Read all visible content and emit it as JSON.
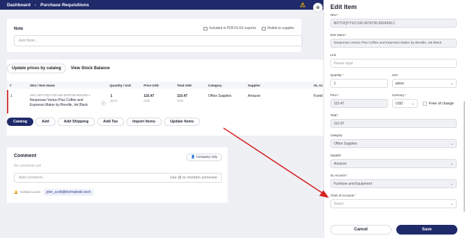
{
  "breadcrumb": {
    "home": "Dashboard",
    "sep": "›",
    "current": "Purchase Requisitions"
  },
  "note": {
    "title": "Note",
    "flag_pdf": "Included in PDF/XLSX exports",
    "flag_supplier": "Visible to supplier",
    "placeholder": "Add Note..."
  },
  "actions": {
    "update_prices": "Update prices by catalog",
    "view_stock": "View Stock Balance"
  },
  "table": {
    "headers": {
      "num": "#",
      "sku": "SKU / Item Name",
      "qty": "Quantity / Unit",
      "price": "Price USD",
      "total": "Total USD",
      "category": "Category",
      "supplier": "Supplier",
      "gl": "GL Ac"
    },
    "row": {
      "num": "1",
      "sku": "SKU: B07Y2QYYXZ:106-3676735-9324200.1",
      "name1": "Nespresso Vertuo Plus Coffee and",
      "name2": "Espresso Maker by Breville, Ink Black",
      "qty": "1",
      "unit": "piece",
      "price": "110.47",
      "price_cur": "USD",
      "total": "110.47",
      "total_cur": "USD",
      "category": "Office Supplies",
      "supplier": "Amazon",
      "gl": "Furnit"
    }
  },
  "tabs": [
    "Catalog",
    "Add",
    "Add Shipping",
    "Add Tax",
    "Import Items",
    "Update Items"
  ],
  "comment": {
    "title": "Comment",
    "company_only": "Company only",
    "empty": "No comments yet",
    "placeholder": "Add comment...",
    "hint": "Use @ to mention someone",
    "notified_label": "Notified users:",
    "notified_user": "john_scott@technaholic.tech"
  },
  "edit_panel": {
    "title": "Edit Item",
    "sku_label": "SKU",
    "sku": "B07Y2QYYXZ:106-3676735-9324200.1",
    "name_label": "Item Name",
    "name": "Nespresso Vertuo Plus Coffee and Espresso Maker by Breville, Ink Black",
    "link_label": "Link",
    "link_placeholder": "Please input",
    "qty_label": "Quantity",
    "qty": "1",
    "unit_label": "Unit",
    "unit": "piece",
    "price_label": "Price",
    "price": "110.47",
    "currency_label": "Currency",
    "currency": "USD",
    "free_of_charge": "Free of charge",
    "total_label": "Total",
    "total": "110.47",
    "category_label": "Category",
    "category": "Office Supplies",
    "supplier_label": "Supplier",
    "supplier": "Amazon",
    "gl_label": "GL Account",
    "gl": "Furniture and Equipment",
    "coa_label": "Chart of Accounts",
    "coa_placeholder": "Select",
    "required_mark": "*",
    "cancel": "Cancel",
    "save": "Save"
  },
  "colors": {
    "brand": "#1f2a6b",
    "annotation": "#d91e1e"
  },
  "icons": {
    "warning": "warning-icon",
    "close": "close-icon"
  }
}
